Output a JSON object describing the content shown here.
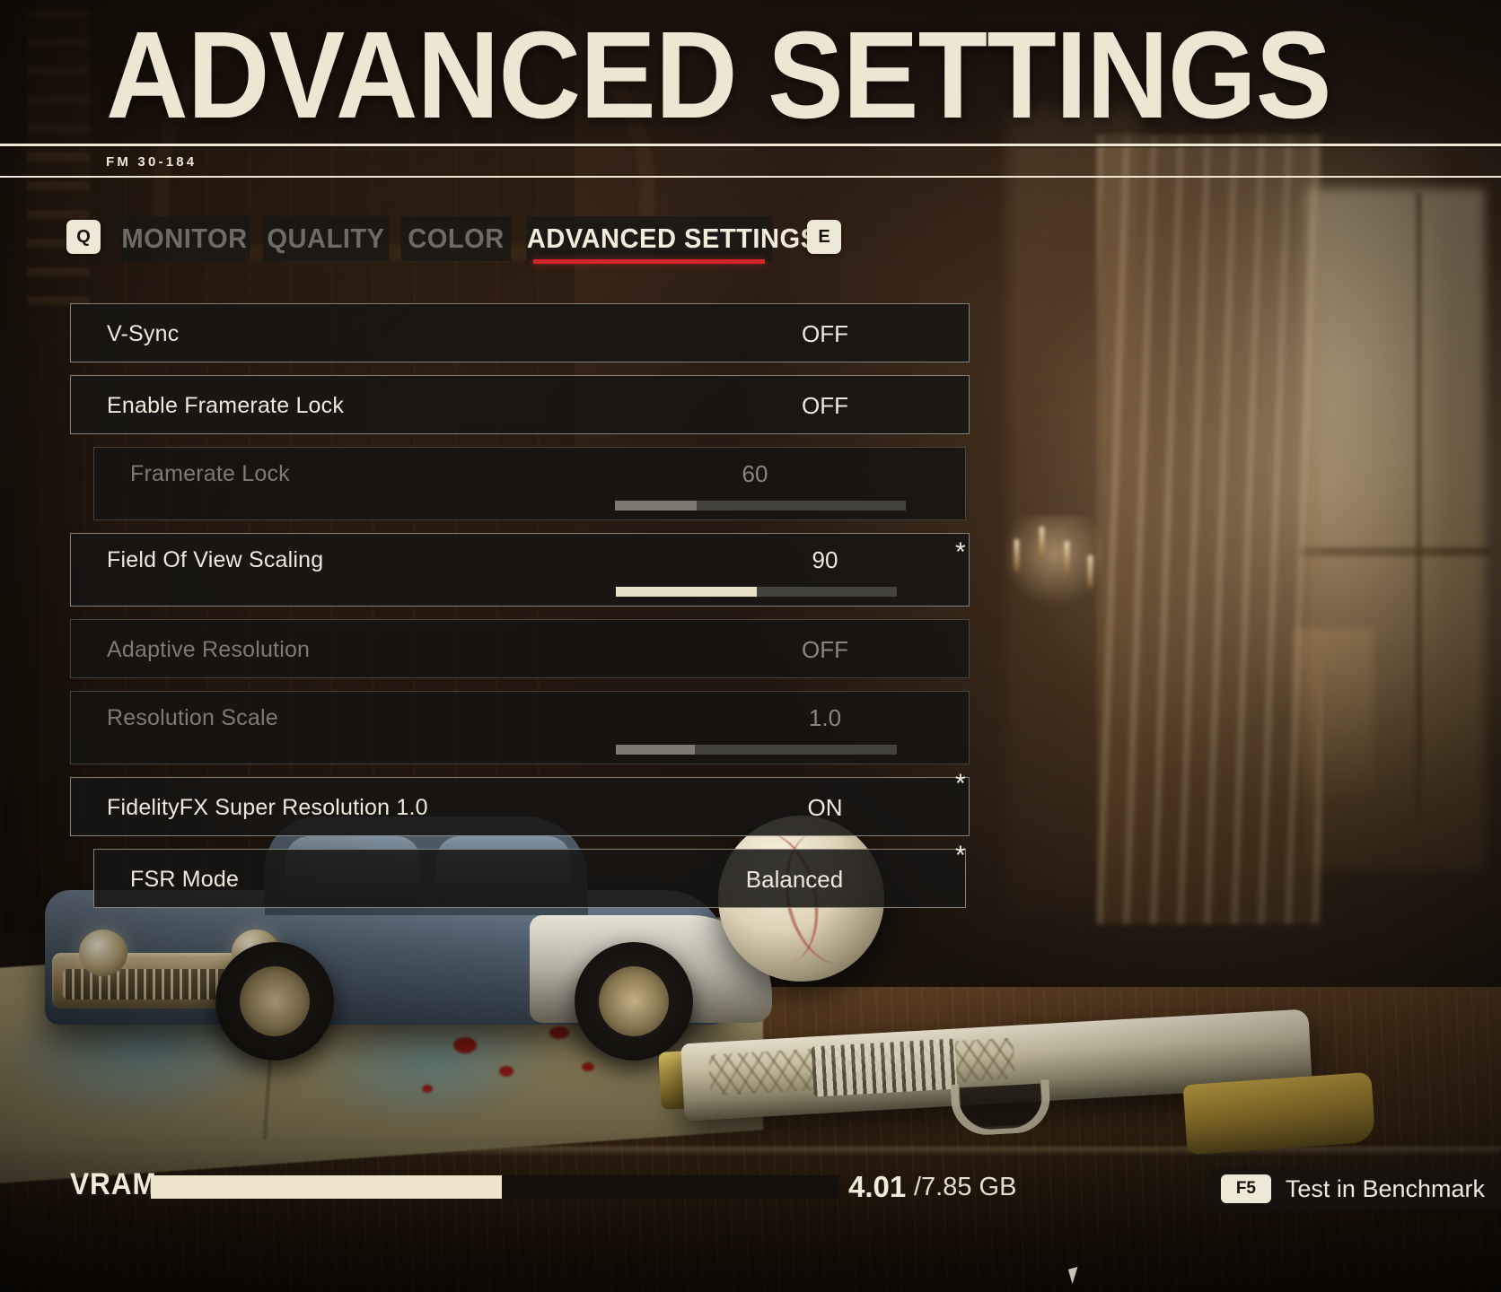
{
  "header": {
    "title": "ADVANCED SETTINGS",
    "code": "FM 30-184"
  },
  "tabbar": {
    "prev_key": "Q",
    "next_key": "E",
    "tabs": [
      {
        "label": "MONITOR",
        "active": false
      },
      {
        "label": "QUALITY",
        "active": false
      },
      {
        "label": "COLOR",
        "active": false
      },
      {
        "label": "ADVANCED SETTINGS",
        "active": true
      }
    ],
    "active_accent": "#d4252a"
  },
  "settings": {
    "rows": [
      {
        "label": "V-Sync",
        "value": "OFF",
        "type": "toggle",
        "disabled": false,
        "indent": false,
        "asterisk": false
      },
      {
        "label": "Enable Framerate Lock",
        "value": "OFF",
        "type": "toggle",
        "disabled": false,
        "indent": false,
        "asterisk": false
      },
      {
        "label": "Framerate Lock",
        "value": "60",
        "type": "slider",
        "disabled": true,
        "indent": true,
        "asterisk": false,
        "fill_percent": 28
      },
      {
        "label": "Field Of View Scaling",
        "value": "90",
        "type": "slider",
        "disabled": false,
        "indent": false,
        "asterisk": true,
        "fill_percent": 50
      },
      {
        "label": "Adaptive Resolution",
        "value": "OFF",
        "type": "toggle",
        "disabled": true,
        "indent": false,
        "asterisk": false
      },
      {
        "label": "Resolution Scale",
        "value": "1.0",
        "type": "slider",
        "disabled": true,
        "indent": false,
        "asterisk": false,
        "fill_percent": 28
      },
      {
        "label": "FidelityFX Super Resolution 1.0",
        "value": "ON",
        "type": "toggle",
        "disabled": false,
        "indent": false,
        "asterisk": true
      },
      {
        "label": "FSR Mode",
        "value": "Balanced",
        "type": "select",
        "disabled": false,
        "indent": true,
        "asterisk": true
      }
    ],
    "asterisk_glyph": "*"
  },
  "footer": {
    "vram_label": "VRAM",
    "vram_used": "4.01",
    "vram_total": "/7.85 GB",
    "vram_percent": 51,
    "benchmark_key": "F5",
    "benchmark_label": "Test in Benchmark"
  }
}
